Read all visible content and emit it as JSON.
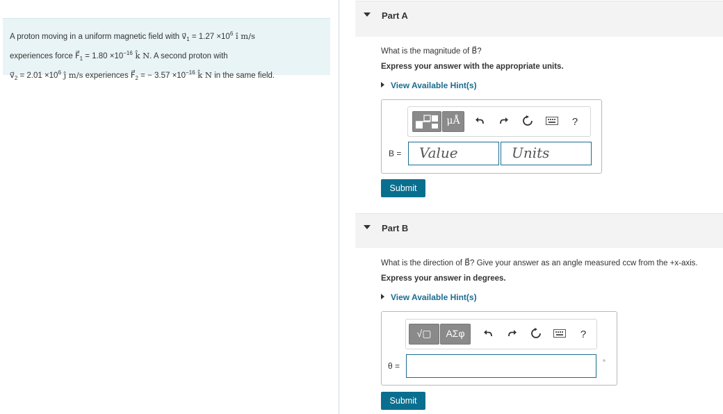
{
  "problem": {
    "line1_pre": "A proton moving in a uniform magnetic field with ",
    "v1_sym": "v⃗",
    "v1_sub": "1",
    "v1_eq": " = 1.27 ×10",
    "v1_exp": "6",
    "v1_unit": " î m/s",
    "line2_pre": "experiences force ",
    "F1_sym": "F⃗",
    "F1_sub": "1",
    "F1_eq": " = 1.80 ×10",
    "F1_exp": "−16",
    "F1_unit": " k̂ N",
    "line2_post": ". A second proton with",
    "v2_sym": "v⃗",
    "v2_sub": "2",
    "v2_eq": " = 2.01 ×10",
    "v2_exp": "6",
    "v2_unit": " ĵ m/s",
    "line3_mid": " experiences ",
    "F2_sym": "F⃗",
    "F2_sub": "2",
    "F2_eq": " = − 3.57 ×10",
    "F2_exp": "−16",
    "F2_unit": " k̂ N",
    "line3_post": " in the same field."
  },
  "partA": {
    "title": "Part A",
    "question": "What is the magnitude of B⃗?",
    "instruction": "Express your answer with the appropriate units.",
    "hint": "View Available Hint(s)",
    "tpl_label": "μÅ",
    "help": "?",
    "var_label": "B =",
    "value_placeholder": "Value",
    "units_placeholder": "Units",
    "submit": "Submit"
  },
  "partB": {
    "title": "Part B",
    "question": "What is the direction of B⃗? Give your answer as an angle measured ccw from the +x-axis.",
    "instruction": "Express your answer in degrees.",
    "hint": "View Available Hint(s)",
    "tpl1_label": "√▢",
    "tpl2_label": "ΑΣφ",
    "help": "?",
    "var_label": "θ =",
    "unit_suffix": "°",
    "submit": "Submit"
  },
  "colors": {
    "accent": "#0a6f8f",
    "link": "#1a6c8e",
    "problem_bg": "#e9f4f6"
  },
  "icons": [
    "undo-icon",
    "redo-icon",
    "reset-icon",
    "keyboard-icon",
    "help-icon"
  ]
}
